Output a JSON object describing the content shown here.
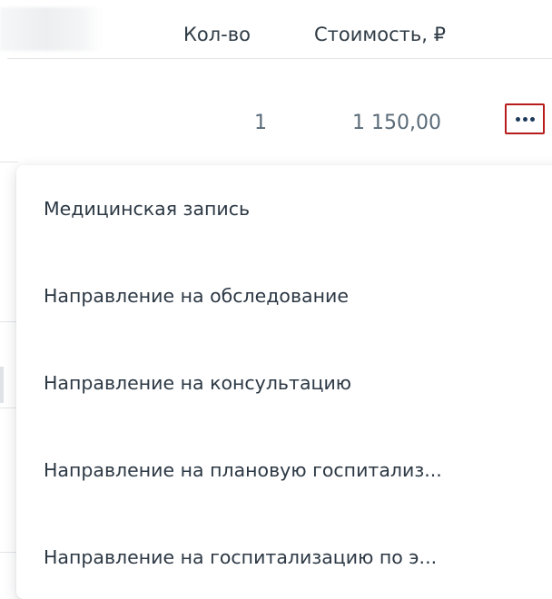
{
  "table": {
    "headers": {
      "quantity": "Кол-во",
      "cost": "Стоимость, ₽"
    },
    "rows": [
      {
        "quantity": "1",
        "cost": "1 150,00"
      }
    ]
  },
  "actions_button": {
    "icon": "more-horizontal-icon",
    "highlight_color": "#b71c1c"
  },
  "dropdown_menu": {
    "items": [
      {
        "label": "Медицинская запись"
      },
      {
        "label": "Направление на обследование"
      },
      {
        "label": "Направление на консультацию"
      },
      {
        "label": "Направление на плановую госпитализ..."
      },
      {
        "label": "Направление на госпитализацию по э..."
      }
    ]
  },
  "colors": {
    "header_text": "#2f3b45",
    "cell_text": "#5a6b78",
    "menu_text": "#2c3844",
    "divider": "#e2e5e8"
  }
}
